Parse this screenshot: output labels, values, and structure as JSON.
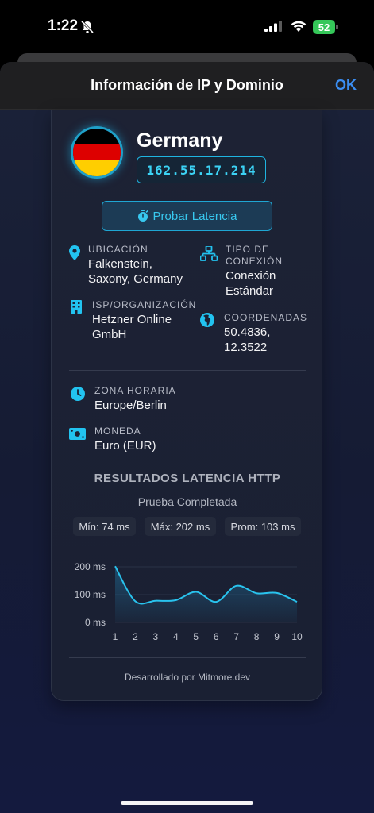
{
  "status_bar": {
    "time": "1:22",
    "battery": "52",
    "icons": [
      "bell-slash-icon",
      "signal-icon",
      "wifi-icon",
      "battery-charging-icon"
    ]
  },
  "nav": {
    "title": "Información de IP y Dominio",
    "ok_label": "OK"
  },
  "card": {
    "country": "Germany",
    "flag_colors": [
      "#000000",
      "#dd0000",
      "#ffce00"
    ],
    "ip": "162.55.17.214",
    "latency_button": "Probar Latencia",
    "info": {
      "location": {
        "label": "UBICACIÓN",
        "value_lines": [
          "Falkenstein,",
          "Saxony, Germany"
        ]
      },
      "connection": {
        "label_lines": [
          "TIPO DE",
          "CONEXIÓN"
        ],
        "value_lines": [
          "Conexión",
          "Estándar"
        ]
      },
      "isp": {
        "label": "ISP/ORGANIZACIÓN",
        "value_lines": [
          "Hetzner Online",
          "GmbH"
        ]
      },
      "coordinates": {
        "label": "COORDENADAS",
        "value_lines": [
          "50.4836,",
          "12.3522"
        ]
      },
      "timezone": {
        "label": "ZONA HORARIA",
        "value": "Europe/Berlin"
      },
      "currency": {
        "label": "MONEDA",
        "value": "Euro (EUR)"
      }
    },
    "latency": {
      "title": "RESULTADOS LATENCIA HTTP",
      "status": "Prueba Completada",
      "min": "Mín: 74 ms",
      "max": "Máx: 202 ms",
      "avg": "Prom: 103 ms"
    },
    "footer": "Desarrollado por Mitmore.dev"
  },
  "colors": {
    "accent": "#1fb4e0",
    "icon": "#22c3f0",
    "ok": "#3b8ef3"
  },
  "chart_data": {
    "type": "area",
    "x": [
      1,
      2,
      3,
      4,
      5,
      6,
      7,
      8,
      9,
      10
    ],
    "values": [
      202,
      76,
      78,
      80,
      110,
      74,
      132,
      105,
      106,
      74
    ],
    "y_ticks": [
      "200 ms",
      "100 ms",
      "0 ms"
    ],
    "ylim": [
      0,
      200
    ],
    "grid": true,
    "xlabel": "",
    "ylabel": ""
  }
}
